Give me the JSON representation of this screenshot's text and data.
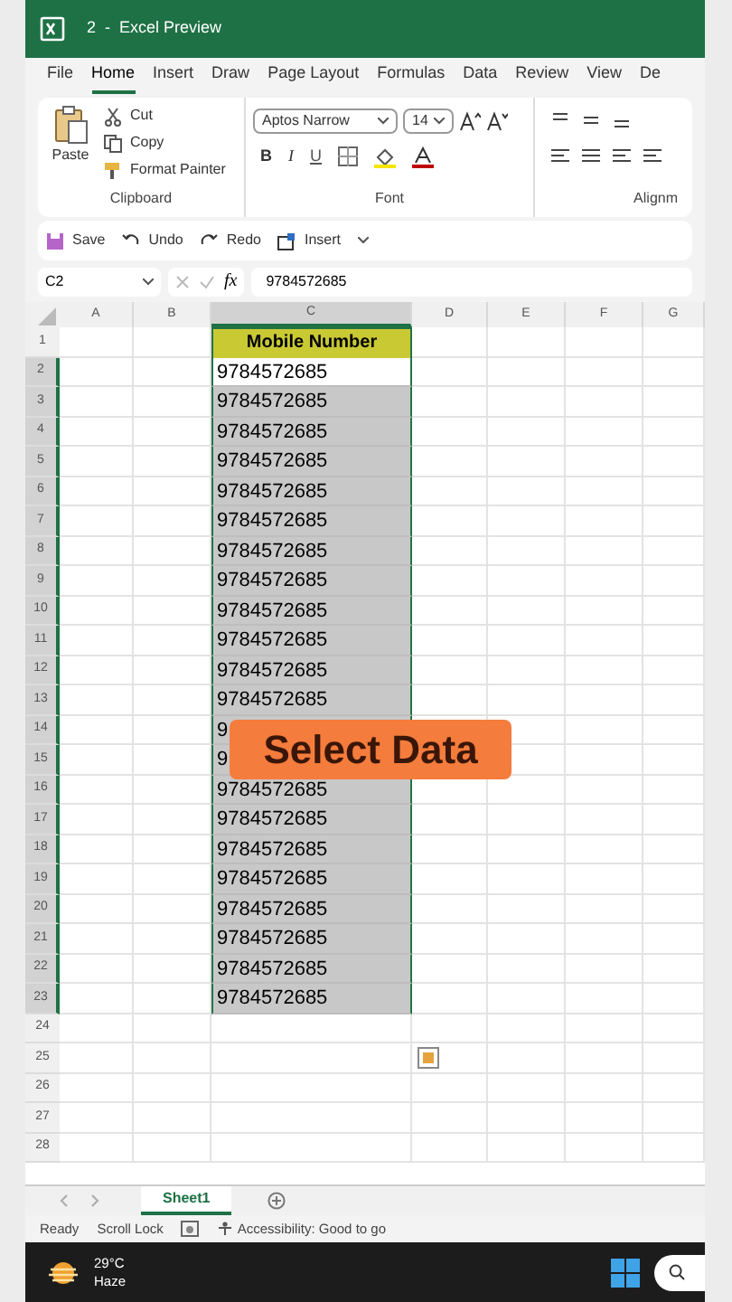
{
  "window": {
    "title": "2  -  Excel Preview"
  },
  "ribbon_tabs": [
    {
      "label": "File",
      "selected": false
    },
    {
      "label": "Home",
      "selected": true
    },
    {
      "label": "Insert",
      "selected": false
    },
    {
      "label": "Draw",
      "selected": false
    },
    {
      "label": "Page Layout",
      "selected": false
    },
    {
      "label": "Formulas",
      "selected": false
    },
    {
      "label": "Data",
      "selected": false
    },
    {
      "label": "Review",
      "selected": false
    },
    {
      "label": "View",
      "selected": false
    },
    {
      "label": "De",
      "selected": false
    }
  ],
  "clipboard": {
    "paste": "Paste",
    "cut": "Cut",
    "copy": "Copy",
    "format_painter": "Format Painter",
    "label": "Clipboard"
  },
  "font": {
    "name": "Aptos Narrow",
    "size": "14",
    "bold": "B",
    "italic": "I",
    "underline": "U",
    "label": "Font"
  },
  "alignment": {
    "label": "Alignm"
  },
  "quick_access": [
    "Save",
    "Undo",
    "Redo",
    "Insert"
  ],
  "formula_bar": {
    "name_box": "C2",
    "fx": "fx",
    "value": "9784572685"
  },
  "columns": [
    "A",
    "B",
    "C",
    "D",
    "E",
    "F",
    "G"
  ],
  "rows": [
    {
      "number": "1",
      "kind": "header",
      "c": "Mobile Number",
      "selected": false,
      "active": false
    },
    {
      "number": "2",
      "kind": "value",
      "c": "9784572685",
      "selected": true,
      "active": true
    },
    {
      "number": "3",
      "kind": "value",
      "c": "9784572685",
      "selected": true,
      "active": false
    },
    {
      "number": "4",
      "kind": "value",
      "c": "9784572685",
      "selected": true,
      "active": false
    },
    {
      "number": "5",
      "kind": "value",
      "c": "9784572685",
      "selected": true,
      "active": false
    },
    {
      "number": "6",
      "kind": "value",
      "c": "9784572685",
      "selected": true,
      "active": false
    },
    {
      "number": "7",
      "kind": "value",
      "c": "9784572685",
      "selected": true,
      "active": false
    },
    {
      "number": "8",
      "kind": "value",
      "c": "9784572685",
      "selected": true,
      "active": false
    },
    {
      "number": "9",
      "kind": "value",
      "c": "9784572685",
      "selected": true,
      "active": false
    },
    {
      "number": "10",
      "kind": "value",
      "c": "9784572685",
      "selected": true,
      "active": false
    },
    {
      "number": "11",
      "kind": "value",
      "c": "9784572685",
      "selected": true,
      "active": false
    },
    {
      "number": "12",
      "kind": "value",
      "c": "9784572685",
      "selected": true,
      "active": false
    },
    {
      "number": "13",
      "kind": "value",
      "c": "9784572685",
      "selected": true,
      "active": false
    },
    {
      "number": "14",
      "kind": "value",
      "c": "9",
      "selected": true,
      "active": false
    },
    {
      "number": "15",
      "kind": "value",
      "c": "9",
      "selected": true,
      "active": false
    },
    {
      "number": "16",
      "kind": "value",
      "c": "9784572685",
      "selected": true,
      "active": false
    },
    {
      "number": "17",
      "kind": "value",
      "c": "9784572685",
      "selected": true,
      "active": false
    },
    {
      "number": "18",
      "kind": "value",
      "c": "9784572685",
      "selected": true,
      "active": false
    },
    {
      "number": "19",
      "kind": "value",
      "c": "9784572685",
      "selected": true,
      "active": false
    },
    {
      "number": "20",
      "kind": "value",
      "c": "9784572685",
      "selected": true,
      "active": false
    },
    {
      "number": "21",
      "kind": "value",
      "c": "9784572685",
      "selected": true,
      "active": false
    },
    {
      "number": "22",
      "kind": "value",
      "c": "9784572685",
      "selected": true,
      "active": false
    },
    {
      "number": "23",
      "kind": "value",
      "c": "9784572685",
      "selected": true,
      "active": false
    },
    {
      "number": "24",
      "kind": "empty"
    },
    {
      "number": "25",
      "kind": "empty"
    },
    {
      "number": "26",
      "kind": "empty"
    },
    {
      "number": "27",
      "kind": "empty"
    },
    {
      "number": "28",
      "kind": "empty"
    }
  ],
  "overlay": {
    "text": "Select Data"
  },
  "sheet_tabs": [
    {
      "label": "Sheet1",
      "selected": true
    }
  ],
  "status_bar": {
    "ready": "Ready",
    "scroll_lock": "Scroll Lock",
    "accessibility": "Accessibility: Good to go"
  },
  "taskbar": {
    "temperature": "29°C",
    "weather": "Haze"
  }
}
